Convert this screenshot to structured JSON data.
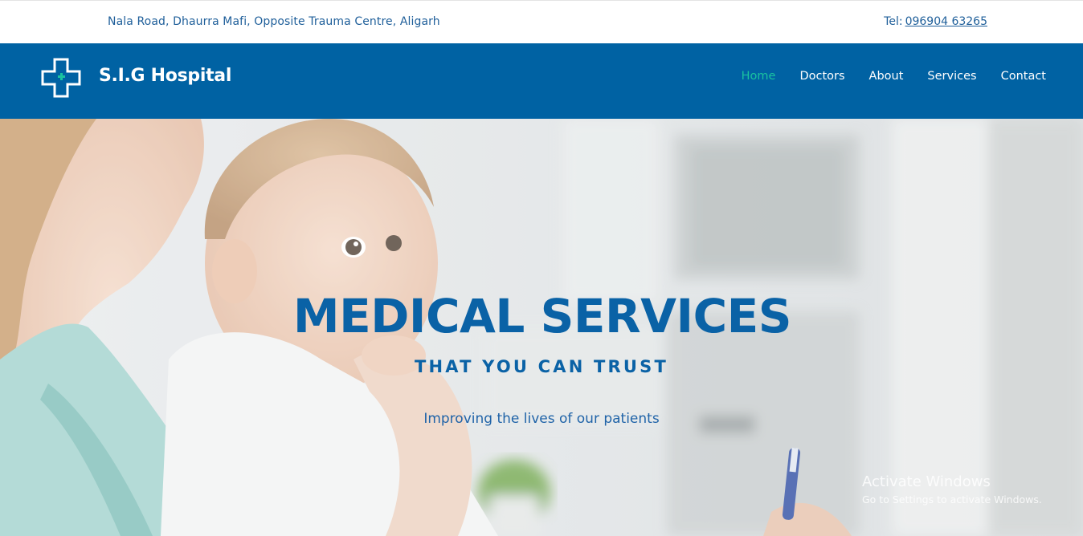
{
  "topbar": {
    "address": "Nala Road, Dhaurra Mafi, Opposite Trauma Centre, Aligarh",
    "tel_label": "Tel:",
    "tel_number": "096904 63265"
  },
  "header": {
    "logo_icon": "medical-cross-icon",
    "site_name": "S.I.G Hospital",
    "nav": [
      {
        "label": "Home",
        "active": true
      },
      {
        "label": "Doctors",
        "active": false
      },
      {
        "label": "About",
        "active": false
      },
      {
        "label": "Services",
        "active": false
      },
      {
        "label": "Contact",
        "active": false
      }
    ],
    "colors": {
      "bar": "#0062a3",
      "active_link": "#19c3a0",
      "link": "#ffffff"
    }
  },
  "hero": {
    "title": "MEDICAL SERVICES",
    "subtitle": "THAT YOU CAN TRUST",
    "tagline": "Improving the lives of our patients",
    "colors": {
      "heading": "#0a62a6"
    }
  },
  "os_watermark": {
    "line1": "Activate Windows",
    "line2": "Go to Settings to activate Windows."
  }
}
